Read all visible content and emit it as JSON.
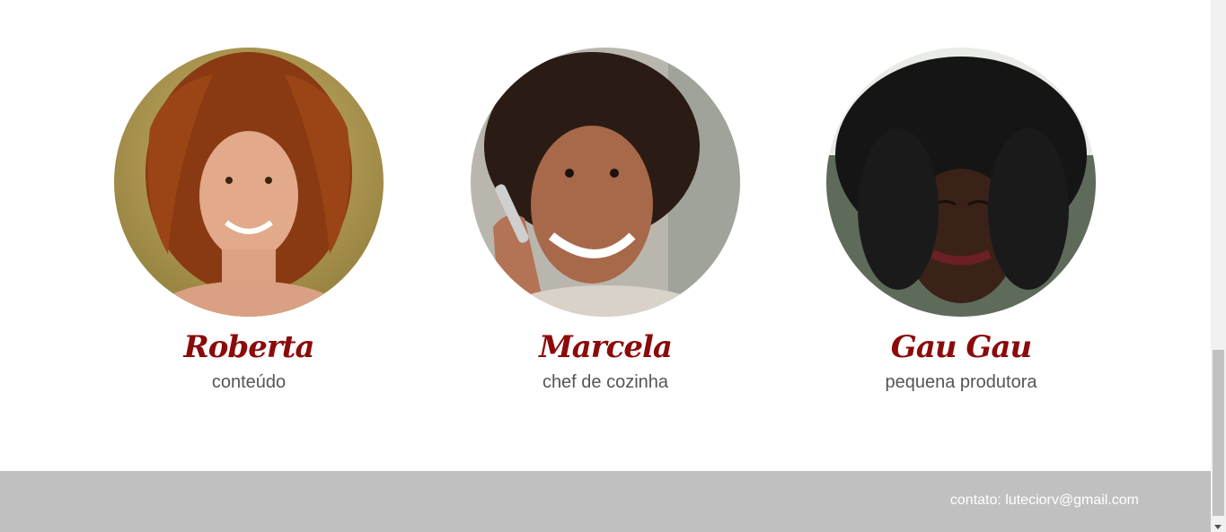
{
  "team": [
    {
      "name": "Roberta",
      "role": "conteúdo",
      "photo_icon": "woman-portrait"
    },
    {
      "name": "Marcela",
      "role": "chef de cozinha",
      "photo_icon": "woman-phone-portrait"
    },
    {
      "name": "Gau Gau",
      "role": "pequena produtora",
      "photo_icon": "woman-portrait"
    }
  ],
  "footer": {
    "contact": "contato: luteciorv@gmail.com"
  },
  "colors": {
    "name": "#8b0a0a",
    "role": "#555555",
    "footer_bg": "#c0c0c0",
    "footer_text": "#ffffff"
  }
}
